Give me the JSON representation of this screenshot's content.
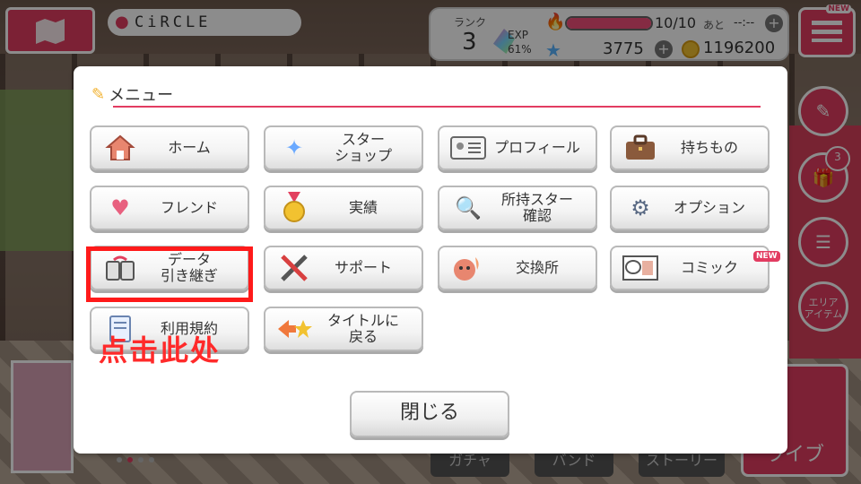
{
  "location": {
    "name": "CiRCLE"
  },
  "status": {
    "rank_label": "ランク",
    "rank_value": "3",
    "exp_label": "EXP",
    "exp_percent": "61%",
    "energy_value": "10/10",
    "energy_fill_fraction": 1.0,
    "energy_after_label": "あと",
    "energy_timer": "--:--",
    "stars_value": "3775",
    "coins_value": "1196200"
  },
  "menu_button": {
    "new_label": "NEW"
  },
  "side": {
    "present_badge": "3",
    "area_label_line1": "エリア",
    "area_label_line2": "アイテム"
  },
  "bottom_tabs": {
    "tab1": "ガチャ",
    "tab2": "バンド",
    "tab3": "ストーリー",
    "live": "ライブ"
  },
  "dialog": {
    "title": "メニュー",
    "buttons": [
      {
        "label": "ホーム",
        "icon": "home-icon"
      },
      {
        "label": "スター\nショップ",
        "icon": "star-shop-icon"
      },
      {
        "label": "プロフィール",
        "icon": "profile-card-icon"
      },
      {
        "label": "持ちもの",
        "icon": "bag-icon"
      },
      {
        "label": "フレンド",
        "icon": "friend-heart-icon"
      },
      {
        "label": "実績",
        "icon": "medal-icon"
      },
      {
        "label": "所持スター\n確認",
        "icon": "star-search-icon"
      },
      {
        "label": "オプション",
        "icon": "gear-icon"
      },
      {
        "label": "データ\n引き継ぎ",
        "icon": "data-transfer-icon"
      },
      {
        "label": "サポート",
        "icon": "tools-icon"
      },
      {
        "label": "交換所",
        "icon": "exchange-icon"
      },
      {
        "label": "コミック",
        "icon": "comic-icon"
      },
      {
        "label": "利用規約",
        "icon": "terms-icon"
      },
      {
        "label": "タイトルに\n戻る",
        "icon": "back-to-title-icon"
      }
    ],
    "comic_new": "NEW",
    "close_label": "閉じる"
  },
  "annotation": {
    "text": "点击此处"
  },
  "colors": {
    "accent": "#e23c61",
    "highlight": "#ff1a1a"
  }
}
